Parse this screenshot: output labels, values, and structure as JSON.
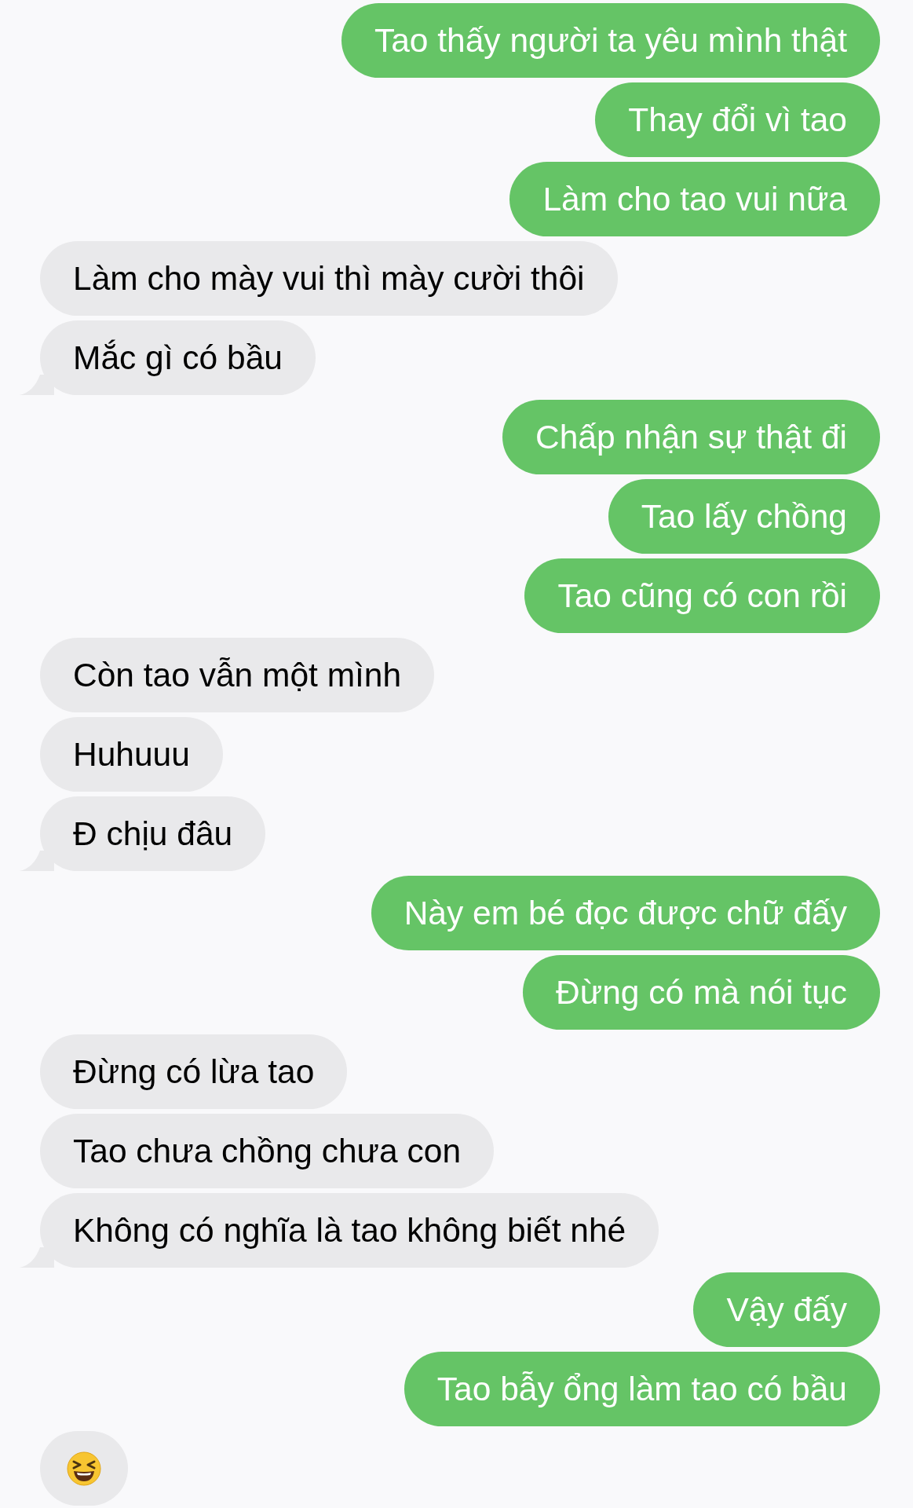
{
  "messages": [
    {
      "outgoing": true,
      "kind": "text",
      "text": "Tao thấy người ta yêu mình thật",
      "tail": false
    },
    {
      "outgoing": true,
      "kind": "text",
      "text": "Thay đổi vì tao",
      "tail": false
    },
    {
      "outgoing": true,
      "kind": "text",
      "text": "Làm cho tao vui nữa",
      "tail": false
    },
    {
      "outgoing": false,
      "kind": "text",
      "text": "Làm cho mày vui thì mày cười thôi",
      "tail": false
    },
    {
      "outgoing": false,
      "kind": "text",
      "text": "Mắc gì có bầu",
      "tail": true
    },
    {
      "outgoing": true,
      "kind": "text",
      "text": "Chấp nhận sự thật đi",
      "tail": false
    },
    {
      "outgoing": true,
      "kind": "text",
      "text": "Tao lấy chồng",
      "tail": false
    },
    {
      "outgoing": true,
      "kind": "text",
      "text": "Tao cũng có con rồi",
      "tail": false
    },
    {
      "outgoing": false,
      "kind": "text",
      "text": "Còn tao vẫn một mình",
      "tail": false
    },
    {
      "outgoing": false,
      "kind": "text",
      "text": "Huhuuu",
      "tail": false
    },
    {
      "outgoing": false,
      "kind": "text",
      "text": "Đ chịu đâu",
      "tail": true
    },
    {
      "outgoing": true,
      "kind": "text",
      "text": "Này em bé đọc được chữ đấy",
      "tail": false
    },
    {
      "outgoing": true,
      "kind": "text",
      "text": "Đừng có mà nói tục",
      "tail": false
    },
    {
      "outgoing": false,
      "kind": "text",
      "text": "Đừng có lừa tao",
      "tail": false
    },
    {
      "outgoing": false,
      "kind": "text",
      "text": "Tao chưa chồng chưa con",
      "tail": false
    },
    {
      "outgoing": false,
      "kind": "text",
      "text": "Không có nghĩa là tao không biết nhé",
      "tail": true
    },
    {
      "outgoing": true,
      "kind": "text",
      "text": "Vậy đấy",
      "tail": false
    },
    {
      "outgoing": true,
      "kind": "text",
      "text": "Tao bẫy ổng làm tao có bầu",
      "tail": false
    },
    {
      "outgoing": false,
      "kind": "emoji",
      "tail": false
    }
  ]
}
